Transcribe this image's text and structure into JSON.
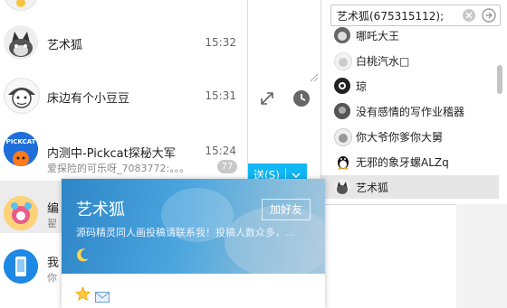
{
  "chats": [
    {
      "name": "艺术狐",
      "time": "15:32",
      "preview": ""
    },
    {
      "name": "床边有个小豆豆",
      "time": "15:31",
      "preview": ""
    },
    {
      "name": "内测中-Pickcat探秘大军",
      "time": "15:24",
      "preview": "爱探险的可乐呀_7083772:。。。",
      "badge": "77"
    },
    {
      "name": "编",
      "time": "",
      "preview": "翟"
    },
    {
      "name": "我",
      "time": "",
      "preview": "你"
    }
  ],
  "composer": {
    "send_label": "送(S)"
  },
  "search": {
    "value": "艺术狐(675315112);"
  },
  "members": [
    {
      "name": "哪吒大王"
    },
    {
      "name": "白桃汽水□"
    },
    {
      "name": "琼"
    },
    {
      "name": "没有感情的写作业稽器"
    },
    {
      "name": "你大爷你爹你大舅"
    },
    {
      "name": "无邪的象牙螺ALZq"
    },
    {
      "name": "艺术狐",
      "selected": true
    }
  ],
  "profile_card": {
    "name": "艺术狐",
    "signature": "源码精灵同人画投稿请联系我！投稿人数众多，...",
    "add_friend_label": "加好友"
  },
  "colors": {
    "accent": "#12b7f5",
    "card_header": "#3b95d3"
  }
}
